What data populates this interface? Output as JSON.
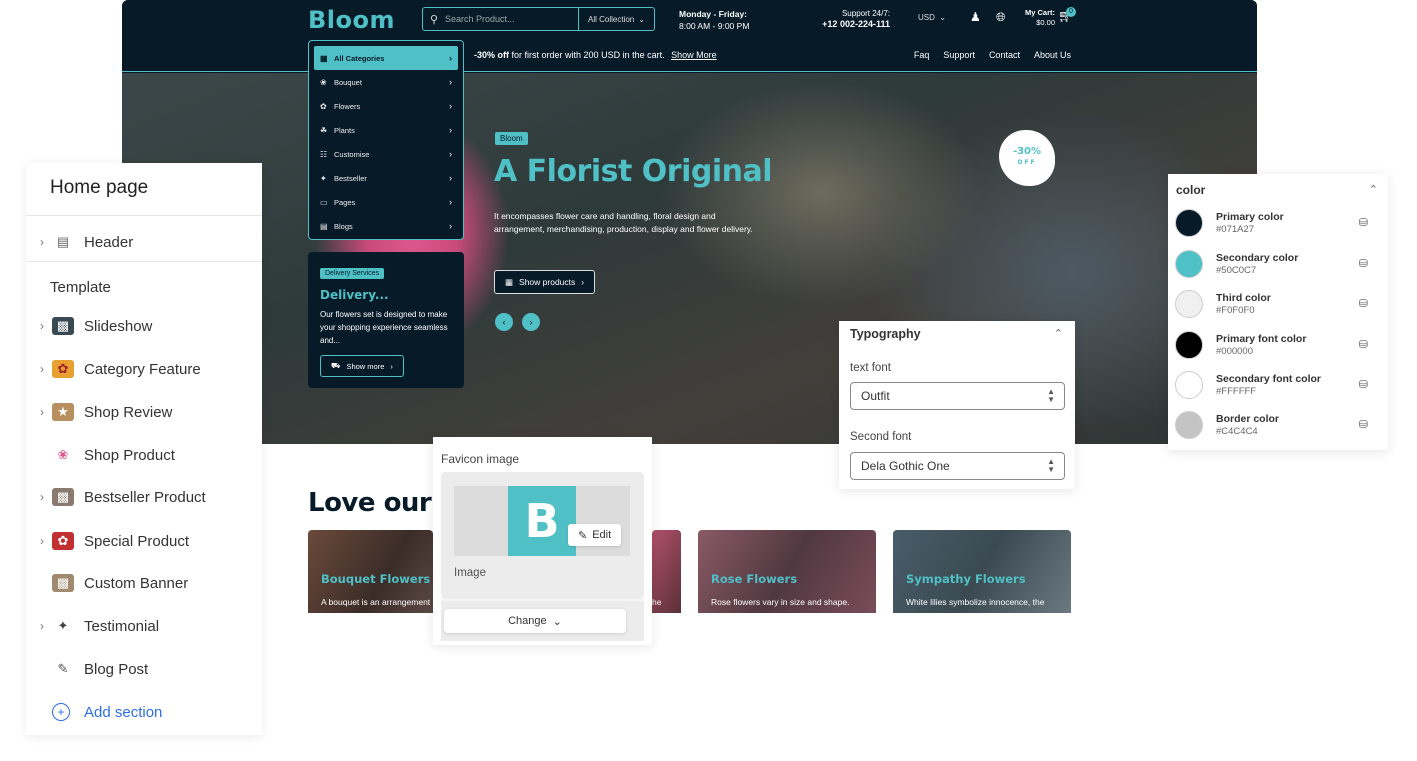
{
  "store": {
    "logo": "Bloom",
    "search_placeholder": "Search Product...",
    "collection": "All Collection",
    "hours_title": "Monday - Friday:",
    "hours_time": "8:00 AM - 9:00 PM",
    "support_title": "Support 24/7:",
    "support_phone": "+12 002-224-111",
    "currency": "USD",
    "cart_label": "My Cart:",
    "cart_total": "$0.00",
    "cart_count": "0",
    "promo_bold": "-30% off",
    "promo_text": "for first order with 200 USD in the cart.",
    "promo_link": "Show More",
    "nav": [
      "Faq",
      "Support",
      "Contact",
      "About Us"
    ],
    "categories": [
      {
        "label": "All Categories",
        "icon": "grid-icon"
      },
      {
        "label": "Bouquet",
        "icon": "bouquet-icon"
      },
      {
        "label": "Flowers",
        "icon": "flower-icon"
      },
      {
        "label": "Plants",
        "icon": "plant-icon"
      },
      {
        "label": "Customise",
        "icon": "customise-icon"
      },
      {
        "label": "Bestseller",
        "icon": "star-icon"
      },
      {
        "label": "Pages",
        "icon": "page-icon"
      },
      {
        "label": "Blogs",
        "icon": "blog-icon"
      }
    ],
    "delivery_badge": "Delivery Services",
    "delivery_title": "Delivery...",
    "delivery_text": "Our flowers set is designed to make your shopping experience seamless and...",
    "delivery_button": "Show more",
    "hero_badge": "Bloom",
    "hero_title": "A Florist Original",
    "hero_text": "It encompasses flower care and handling, floral design and arrangement, merchandising, production, display and flower delivery.",
    "hero_button": "Show products",
    "sale_top": "-30%",
    "sale_bottom": "OFF",
    "love_title": "Love our",
    "products": [
      {
        "title": "Bouquet Flowers",
        "desc": "A bouquet is an arrangement"
      },
      {
        "title": "",
        "desc": "he"
      },
      {
        "title": "Rose Flowers",
        "desc": "Rose flowers vary in size and shape."
      },
      {
        "title": "Sympathy Flowers",
        "desc": "White lilies symbolize innocence, the"
      }
    ]
  },
  "sidebar": {
    "title": "Home page",
    "header_item": "Header",
    "template_label": "Template",
    "items": [
      {
        "label": "Slideshow",
        "has_chevron": true
      },
      {
        "label": "Category Feature",
        "has_chevron": true
      },
      {
        "label": "Shop Review",
        "has_chevron": true
      },
      {
        "label": "Shop Product",
        "has_chevron": false
      },
      {
        "label": "Bestseller Product",
        "has_chevron": true
      },
      {
        "label": "Special Product",
        "has_chevron": true
      },
      {
        "label": "Custom Banner",
        "has_chevron": false
      },
      {
        "label": "Testimonial",
        "has_chevron": true
      },
      {
        "label": "Blog Post",
        "has_chevron": false
      }
    ],
    "add_section": "Add section"
  },
  "favicon": {
    "label": "Favicon image",
    "letter": "B",
    "edit": "Edit",
    "image_label": "Image",
    "change": "Change"
  },
  "typography": {
    "title": "Typography",
    "text_font_label": "text font",
    "text_font_value": "Outfit",
    "second_font_label": "Second font",
    "second_font_value": "Dela Gothic One"
  },
  "color": {
    "title": "color",
    "rows": [
      {
        "name": "Primary color",
        "value": "#071A27",
        "swatch": "#071a27"
      },
      {
        "name": "Secondary color",
        "value": "#50C0C7",
        "swatch": "#50c0c7"
      },
      {
        "name": "Third color",
        "value": "#F0F0F0",
        "swatch": "#f0f0f0"
      },
      {
        "name": "Primary font color",
        "value": "#000000",
        "swatch": "#000000"
      },
      {
        "name": "Secondary font color",
        "value": "#FFFFFF",
        "swatch": "#ffffff"
      },
      {
        "name": "Border color",
        "value": "#C4C4C4",
        "swatch": "#c4c4c4"
      }
    ]
  }
}
